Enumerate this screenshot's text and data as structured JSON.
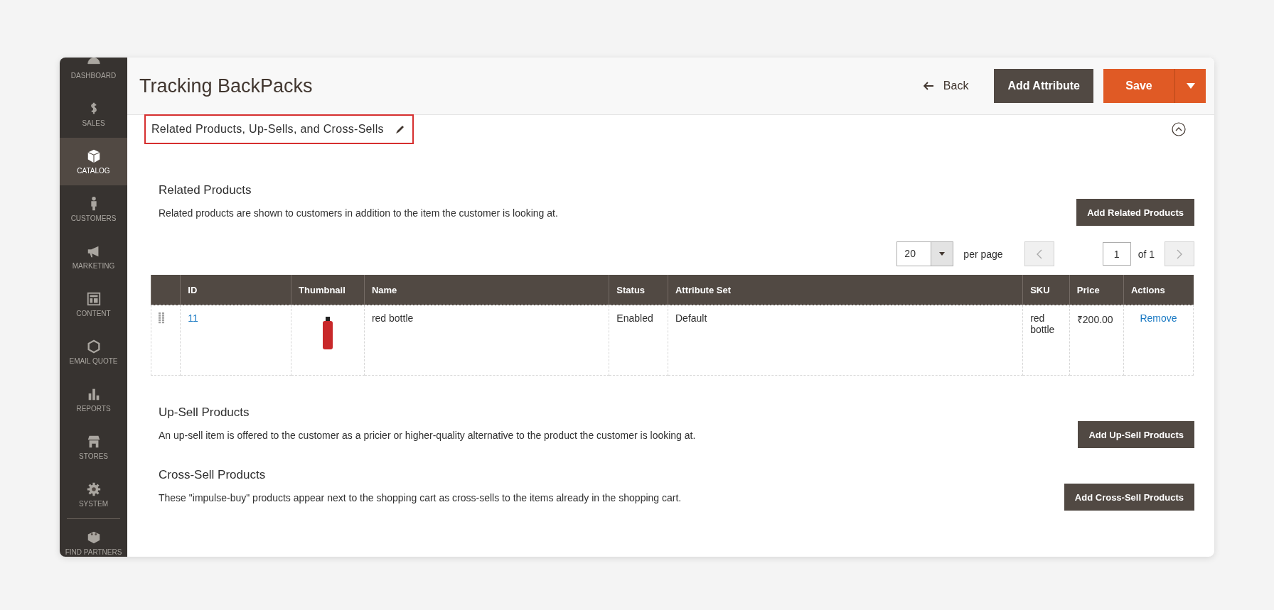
{
  "sidebar": {
    "items": [
      {
        "label": "DASHBOARD",
        "selected": false
      },
      {
        "label": "SALES",
        "selected": false
      },
      {
        "label": "CATALOG",
        "selected": true
      },
      {
        "label": "CUSTOMERS",
        "selected": false
      },
      {
        "label": "MARKETING",
        "selected": false
      },
      {
        "label": "CONTENT",
        "selected": false
      },
      {
        "label": "EMAIL QUOTE",
        "selected": false
      },
      {
        "label": "REPORTS",
        "selected": false
      },
      {
        "label": "STORES",
        "selected": false
      },
      {
        "label": "SYSTEM",
        "selected": false
      },
      {
        "label": "FIND PARTNERS",
        "selected": false
      }
    ]
  },
  "header": {
    "title": "Tracking BackPacks",
    "back": "Back",
    "add_attribute": "Add Attribute",
    "save": "Save"
  },
  "panel": {
    "title": "Related Products, Up-Sells, and Cross-Sells",
    "highlighted": true,
    "expanded": true
  },
  "sections": [
    {
      "kind": "grid",
      "title": "Related Products",
      "description": "Related products are shown to customers in addition to the item the customer is looking at.",
      "button": "Add Related Products"
    },
    {
      "kind": "plain",
      "title": "Up-Sell Products",
      "description": "An up-sell item is offered to the customer as a pricier or higher-quality alternative to the product the customer is looking at.",
      "button": "Add Up-Sell Products"
    },
    {
      "kind": "plain",
      "title": "Cross-Sell Products",
      "description": "These \"impulse-buy\" products appear next to the shopping cart as cross-sells to the items already in the shopping cart.",
      "button": "Add Cross-Sell Products"
    }
  ],
  "pager": {
    "per_page": "20",
    "per_page_label": "per page",
    "page": "1",
    "total": "of 1"
  },
  "table": {
    "columns": [
      "ID",
      "Thumbnail",
      "Name",
      "Status",
      "Attribute Set",
      "SKU",
      "Price",
      "Actions"
    ],
    "rows": [
      {
        "id": "11",
        "name": "red bottle",
        "status": "Enabled",
        "attribute_set": "Default",
        "sku": "red bottle",
        "price": "₹200.00",
        "action": "Remove"
      }
    ]
  }
}
